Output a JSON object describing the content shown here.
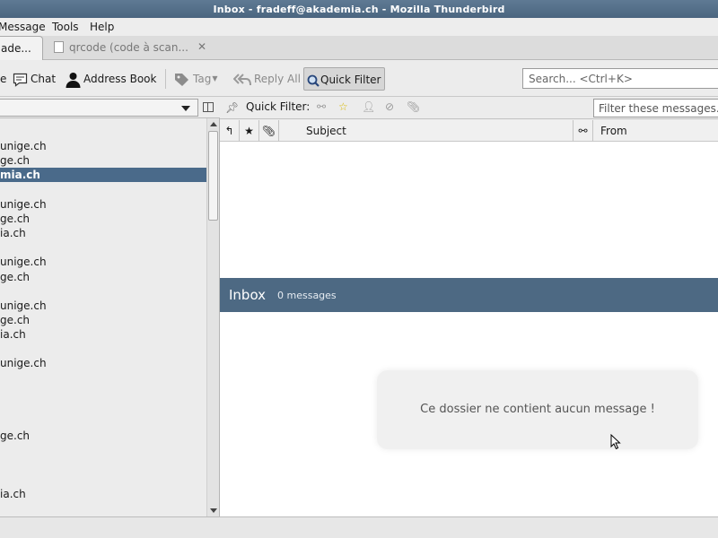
{
  "window": {
    "title": "Inbox - fradeff@akademia.ch - Mozilla Thunderbird"
  },
  "menubar": {
    "items": [
      "Message",
      "Tools",
      "Help"
    ]
  },
  "tabs": [
    {
      "label": "ade...",
      "active": true
    },
    {
      "label": "qrcode (code à scan...",
      "active": false
    }
  ],
  "toolbar": {
    "partial_label": "e",
    "chat": "Chat",
    "address_book": "Address Book",
    "tag": "Tag",
    "reply_all": "Reply All",
    "quick_filter": "Quick Filter",
    "search_placeholder": "Search... <Ctrl+K>"
  },
  "folders": [
    {
      "label": "",
      "selected": false
    },
    {
      "label": "unige.ch",
      "selected": false
    },
    {
      "label": "ge.ch",
      "selected": false
    },
    {
      "label": "mia.ch",
      "selected": true
    },
    {
      "label": "",
      "selected": false
    },
    {
      "label": "unige.ch",
      "selected": false
    },
    {
      "label": "ge.ch",
      "selected": false
    },
    {
      "label": "ia.ch",
      "selected": false
    },
    {
      "label": "",
      "selected": false
    },
    {
      "label": "unige.ch",
      "selected": false
    },
    {
      "label": "ge.ch",
      "selected": false
    },
    {
      "label": "",
      "selected": false
    },
    {
      "label": "unige.ch",
      "selected": false
    },
    {
      "label": "ge.ch",
      "selected": false
    },
    {
      "label": "ia.ch",
      "selected": false
    },
    {
      "label": "",
      "selected": false
    },
    {
      "label": "unige.ch",
      "selected": false
    },
    {
      "label": "",
      "selected": false
    },
    {
      "label": "",
      "selected": false
    },
    {
      "label": "",
      "selected": false
    },
    {
      "label": "",
      "selected": false
    },
    {
      "label": "ge.ch",
      "selected": false
    },
    {
      "label": "",
      "selected": false
    },
    {
      "label": "",
      "selected": false
    },
    {
      "label": "",
      "selected": false
    },
    {
      "label": "ia.ch",
      "selected": false
    }
  ],
  "quick_filter": {
    "label": "Quick Filter:",
    "filter_placeholder": "Filter these messages..."
  },
  "columns": {
    "subject": "Subject",
    "from": "From"
  },
  "message_pane": {
    "folder_name": "Inbox",
    "count": "0 messages",
    "empty_text": "Ce dossier ne contient aucun message !"
  },
  "colors": {
    "selection": "#4a6a8a",
    "header_bar": "#4d6983",
    "titlebar": "#56708a"
  }
}
